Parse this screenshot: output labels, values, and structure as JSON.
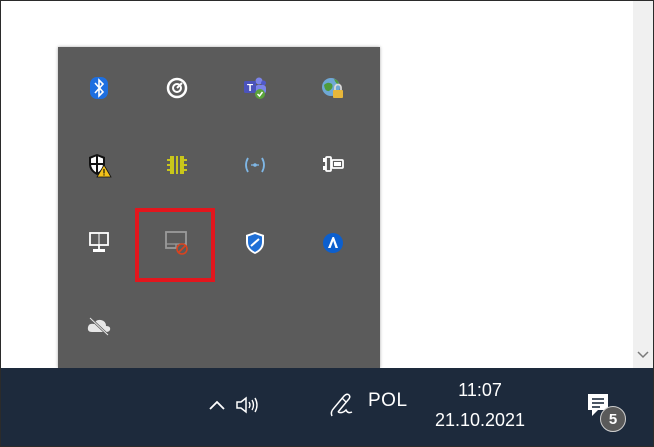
{
  "tray_overflow": {
    "icons": [
      "bluetooth-icon",
      "clock-app-icon",
      "teams-icon",
      "network-locked-icon",
      "security-warning-icon",
      "memory-chip-icon",
      "wireless-display-icon",
      "power-plug-icon",
      "network-monitor-icon",
      "touchpad-disabled-icon",
      "defender-shield-icon",
      "autodesk-icon",
      "onedrive-offline-icon"
    ],
    "highlighted_icon": "touchpad-disabled-icon",
    "highlight_color": "#e3161d"
  },
  "taskbar": {
    "language": "POL",
    "time": "11:07",
    "date": "21.10.2021",
    "notification_count": "5",
    "background_color": "#1d2a3c"
  },
  "colors": {
    "panel": "#5b5b5b",
    "bluetooth": "#1e6fe0",
    "defender": "#1f6fd6",
    "chip": "#c9c61a"
  }
}
